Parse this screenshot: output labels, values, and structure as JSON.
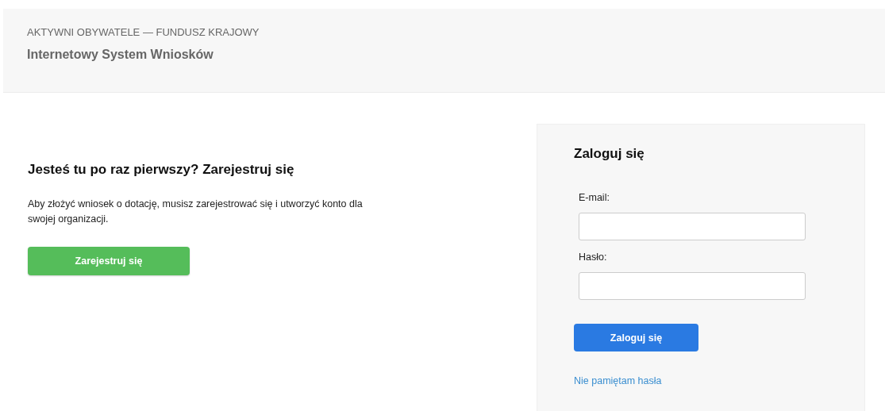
{
  "header": {
    "subtitle": "AKTYWNI OBYWATELE — FUNDUSZ KRAJOWY",
    "title": "Internetowy System Wniosków"
  },
  "register": {
    "heading": "Jesteś tu po raz pierwszy? Zarejestruj się",
    "text": "Aby złożyć wniosek o dotację, musisz zarejestrować się i utworzyć konto dla swojej organizacji.",
    "button": "Zarejestruj się"
  },
  "login": {
    "heading": "Zaloguj się",
    "fields": [
      {
        "label": "E-mail:"
      },
      {
        "label": "Hasło:"
      }
    ],
    "button": "Zaloguj się",
    "link": "Nie pamiętam hasła"
  }
}
